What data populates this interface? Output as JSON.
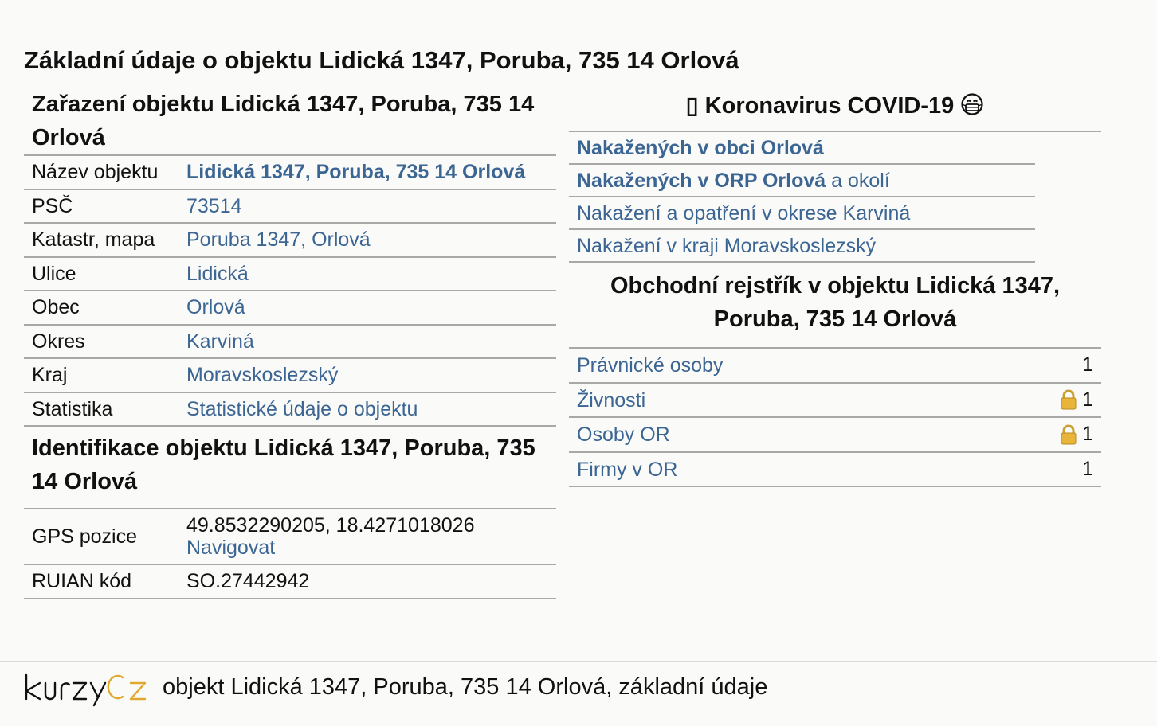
{
  "page_title": "Základní údaje o objektu Lidická 1347, Poruba, 735 14 Orlová",
  "classification": {
    "heading": "Zařazení objektu Lidická 1347, Poruba, 735 14 Orlová",
    "rows": [
      {
        "key": "Název objektu",
        "value": "Lidická 1347, Poruba, 735 14 Orlová",
        "bold": true
      },
      {
        "key": "PSČ",
        "value": "73514"
      },
      {
        "key": "Katastr, mapa",
        "value": "Poruba 1347, Orlová"
      },
      {
        "key": "Ulice",
        "value": "Lidická"
      },
      {
        "key": "Obec",
        "value": "Orlová"
      },
      {
        "key": "Okres",
        "value": "Karviná"
      },
      {
        "key": "Kraj",
        "value": "Moravskoslezský"
      },
      {
        "key": "Statistika",
        "value": "Statistické údaje o objektu"
      }
    ]
  },
  "identification": {
    "heading": "Identifikace objektu Lidická 1347, Poruba, 735 14 Orlová",
    "gps_label": "GPS pozice",
    "gps_value": "49.8532290205, 18.4271018026",
    "navigate_label": "Navigovat",
    "ruian_label": "RUIAN kód",
    "ruian_value": "SO.27442942"
  },
  "covid": {
    "prefix_glyph": "▯",
    "heading": "Koronavirus COVID-19",
    "heading_icon": "mask-face-icon",
    "links": [
      {
        "bold_part": "Nakažených v obci Orlová",
        "rest": ""
      },
      {
        "bold_part": "Nakažených v ORP Orlová",
        "rest": " a okolí"
      },
      {
        "bold_part": "",
        "rest": "Nakažení a opatření v okrese Karviná"
      },
      {
        "bold_part": "",
        "rest": "Nakažení v kraji Moravskoslezský"
      }
    ]
  },
  "business_register": {
    "heading": "Obchodní rejstřík v objektu Lidická 1347, Poruba, 735 14 Orlová",
    "rows": [
      {
        "label": "Právnické osoby",
        "count": "1",
        "locked": false
      },
      {
        "label": "Živnosti",
        "count": "1",
        "locked": true
      },
      {
        "label": "Osoby OR",
        "count": "1",
        "locked": true
      },
      {
        "label": "Firmy v OR",
        "count": "1",
        "locked": false
      }
    ]
  },
  "footer": {
    "logo_text_dark": "kurzy",
    "logo_text_gold": "cz",
    "text": "objekt Lidická 1347, Poruba, 735 14 Orlová, základní údaje"
  },
  "colors": {
    "link": "#3b6593",
    "rule": "#a8a8a8",
    "logo_gold": "#e0a92e",
    "background": "#fafaf8"
  }
}
